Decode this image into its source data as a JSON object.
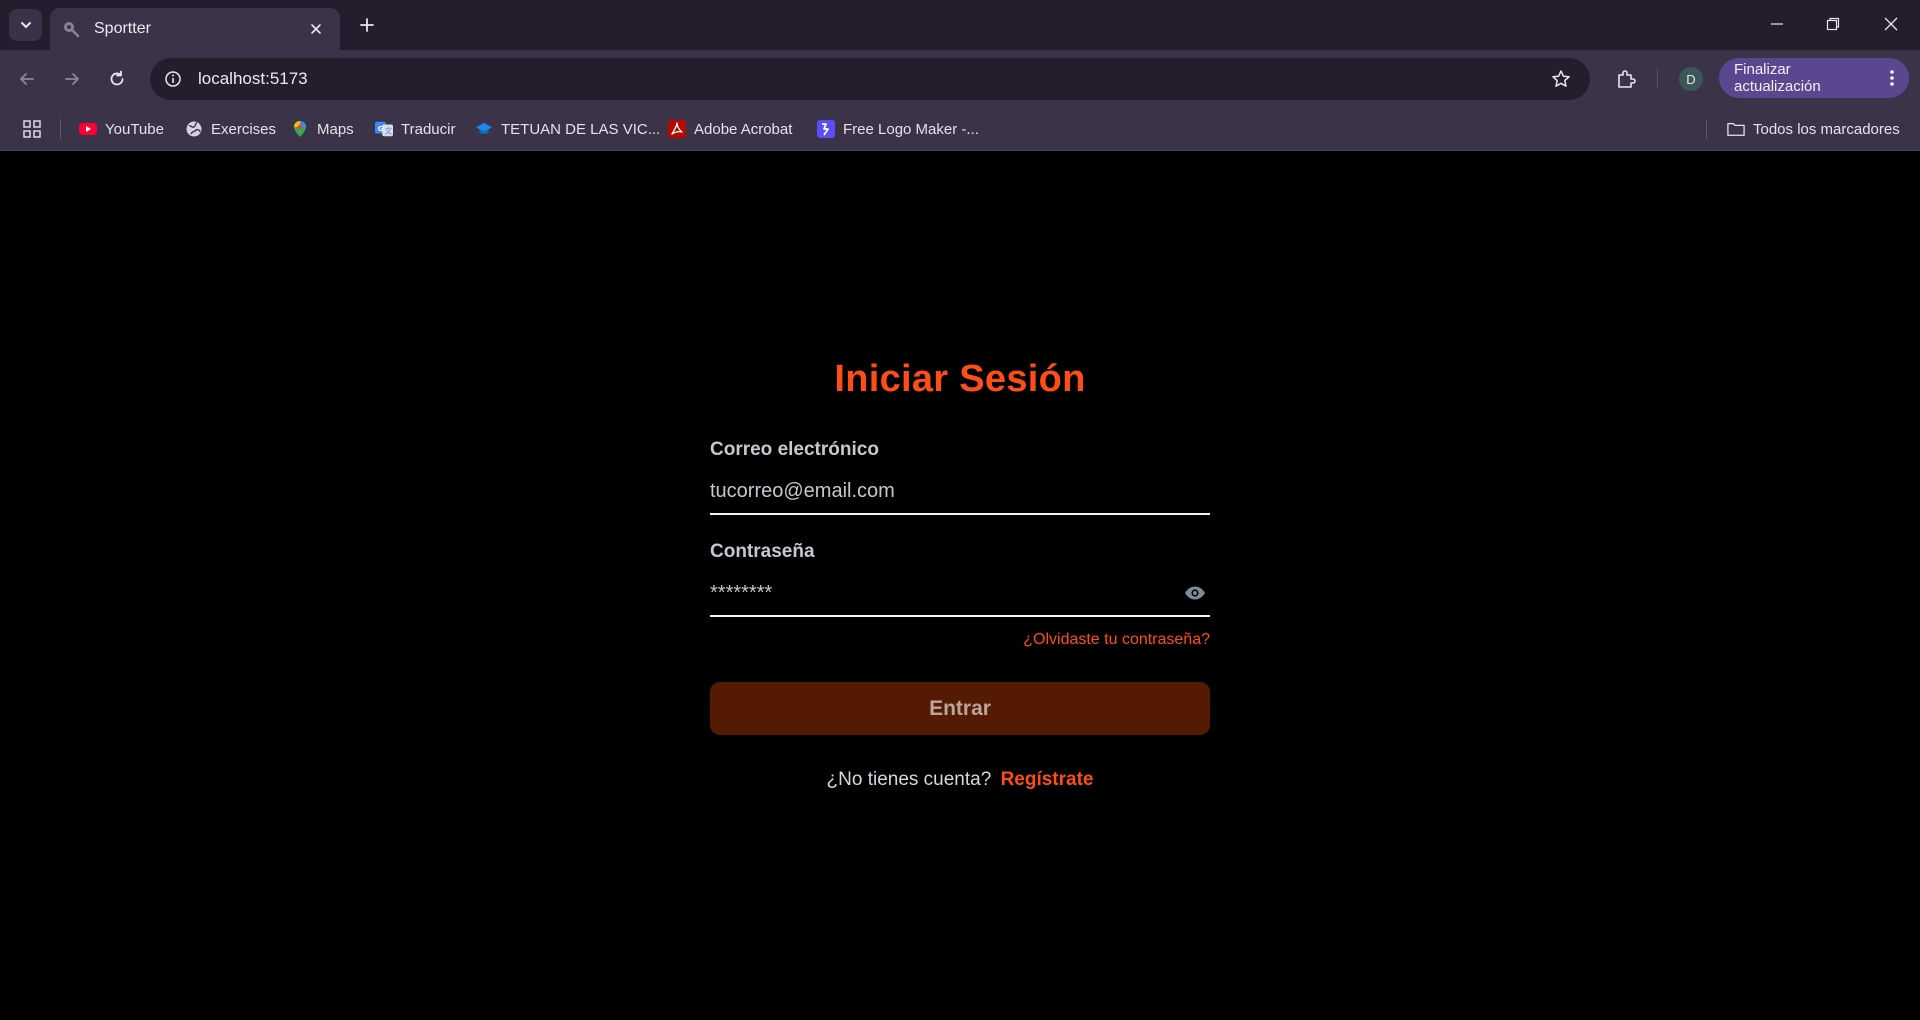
{
  "browser": {
    "tab": {
      "title": "Sportter",
      "favicon": "sportter-favicon"
    },
    "address": {
      "url": "localhost:5173"
    },
    "profile_initial": "D",
    "update_label": "Finalizar actualización",
    "bookmarks": [
      {
        "label": "YouTube",
        "icon": "youtube-icon",
        "color": "#ff0033"
      },
      {
        "label": "Exercises",
        "icon": "globe-icon",
        "color": "#d6d3dc"
      },
      {
        "label": "Maps",
        "icon": "maps-pin-icon",
        "color": "#34a853"
      },
      {
        "label": "Traducir",
        "icon": "translate-icon",
        "color": "#4285f4"
      },
      {
        "label": "TETUAN DE LAS VIC...",
        "icon": "graduation-cap-icon",
        "color": "#1e88e5"
      },
      {
        "label": "Adobe Acrobat",
        "icon": "acrobat-icon",
        "color": "#d7261e"
      },
      {
        "label": "Free Logo Maker -...",
        "icon": "logo-maker-icon",
        "color": "#5b4ef5"
      }
    ],
    "all_bookmarks": "Todos los marcadores"
  },
  "login": {
    "title": "Iniciar Sesión",
    "email_label": "Correo electrónico",
    "email_value": "tucorreo@email.com",
    "password_label": "Contraseña",
    "password_value": "********",
    "forgot_link": "¿Olvidaste tu contraseña?",
    "submit_label": "Entrar",
    "signup_prompt": "¿No tienes cuenta?",
    "signup_link": "Regístrate"
  },
  "colors": {
    "accent": "#ff4d17",
    "button_bg": "#551a03",
    "browser_frame": "#3b3449",
    "page_bg": "#000000"
  }
}
